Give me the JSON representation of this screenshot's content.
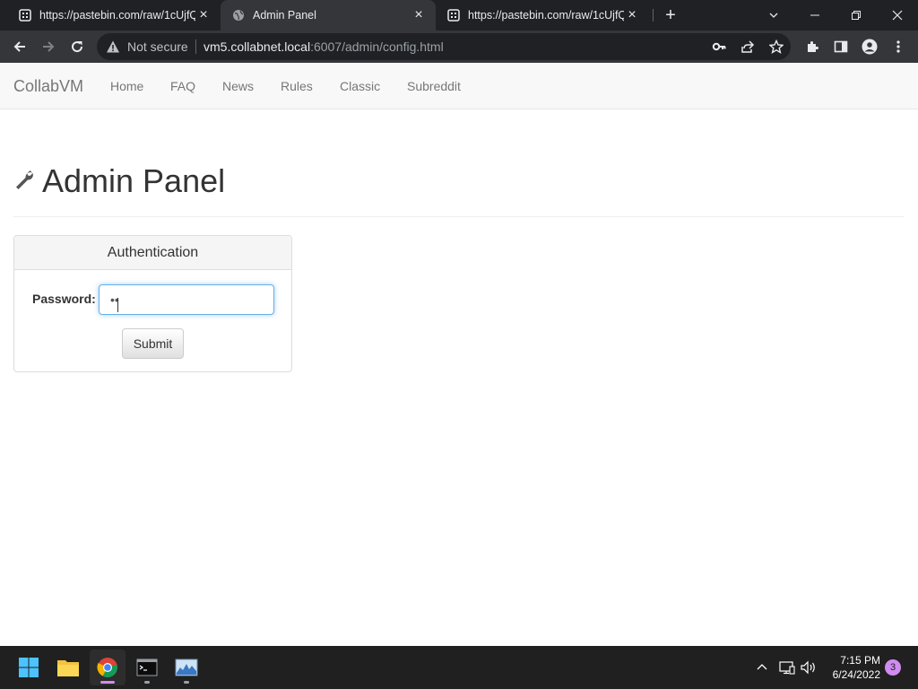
{
  "browser": {
    "tabs": [
      {
        "title": "https://pastebin.com/raw/1cUjfQ",
        "active": false,
        "favicon": "pastebin-icon"
      },
      {
        "title": "Admin Panel",
        "active": true,
        "favicon": "globe-icon"
      },
      {
        "title": "https://pastebin.com/raw/1cUjfQ",
        "active": false,
        "favicon": "pastebin-icon"
      }
    ],
    "security_label": "Not secure",
    "url_host": "vm5.collabnet.local",
    "url_path": ":6007/admin/config.html"
  },
  "site": {
    "brand": "CollabVM",
    "nav": [
      "Home",
      "FAQ",
      "News",
      "Rules",
      "Classic",
      "Subreddit"
    ]
  },
  "page": {
    "title": "Admin Panel",
    "panel_title": "Authentication",
    "password_label": "Password:",
    "password_value": "••",
    "submit_label": "Submit"
  },
  "taskbar": {
    "apps": [
      "start-icon",
      "file-explorer-icon",
      "chrome-icon",
      "terminal-icon",
      "resource-monitor-icon"
    ],
    "time": "7:15 PM",
    "date": "6/24/2022",
    "notification_count": "3"
  },
  "colors": {
    "input_focus": "#66afe9",
    "tab_strip": "#202124",
    "toolbar": "#35363a",
    "taskbar": "#202020"
  }
}
